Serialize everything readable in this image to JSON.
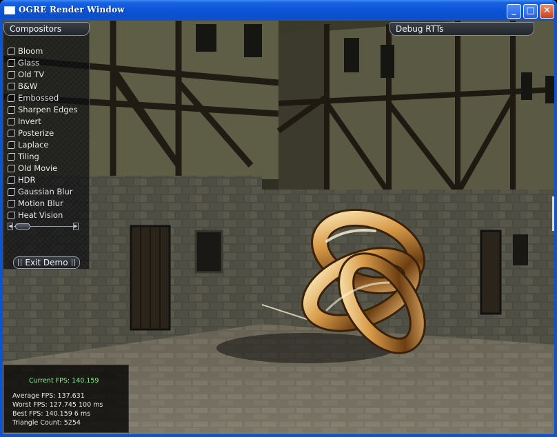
{
  "window": {
    "title": "OGRE Render Window",
    "buttons": {
      "minimize": "_",
      "maximize": "□",
      "close": "✕"
    }
  },
  "compositors_panel": {
    "title": "Compositors",
    "items": [
      {
        "label": "Bloom",
        "checked": false
      },
      {
        "label": "Glass",
        "checked": false
      },
      {
        "label": "Old TV",
        "checked": false
      },
      {
        "label": "B&W",
        "checked": false
      },
      {
        "label": "Embossed",
        "checked": false
      },
      {
        "label": "Sharpen Edges",
        "checked": false
      },
      {
        "label": "Invert",
        "checked": false
      },
      {
        "label": "Posterize",
        "checked": false
      },
      {
        "label": "Laplace",
        "checked": false
      },
      {
        "label": "Tiling",
        "checked": false
      },
      {
        "label": "Old Movie",
        "checked": false
      },
      {
        "label": "HDR",
        "checked": false
      },
      {
        "label": "Gaussian Blur",
        "checked": false
      },
      {
        "label": "Motion Blur",
        "checked": false
      },
      {
        "label": "Heat Vision",
        "checked": false
      }
    ],
    "scroll_left": "◀",
    "scroll_right": "▶",
    "scroll_position": 0
  },
  "debug_panel": {
    "title": "Debug RTTs"
  },
  "exit_button": {
    "label": "Exit Demo"
  },
  "stats": {
    "current_fps": "Current FPS: 140.159",
    "average_fps": "Average FPS: 137.631",
    "worst_fps": "Worst FPS: 127.745 100 ms",
    "best_fps": "Best FPS: 140.159 6 ms",
    "triangle_count": "Triangle Count: 5254"
  },
  "colors": {
    "titlebar": "#0b55d8",
    "stats_current": "#8ff08f",
    "knot": "#c98a3a"
  }
}
